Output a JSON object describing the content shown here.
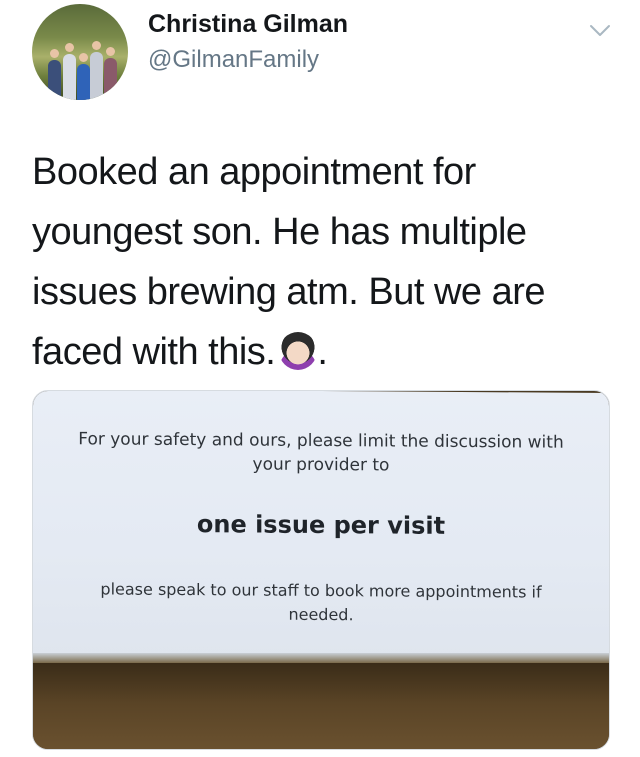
{
  "user": {
    "name": "Christina Gilman",
    "handle": "@GilmanFamily"
  },
  "tweet": {
    "text": "Booked an appointment for youngest son.  He has multiple issues brewing atm.  But we are faced with this.",
    "text_lines": [
      "Booked an appointment for",
      "youngest son.  He has multiple",
      "issues brewing atm.  But we are",
      "faced with this."
    ],
    "trailing_punct": ".",
    "emoji": "woman-facepalming-emoji"
  },
  "media": {
    "sign_line1": "For your safety and ours, please limit the discussion with",
    "sign_line2": "your provider to",
    "sign_headline": "one issue per visit",
    "sign_line3": "please speak to our staff to book more appointments if",
    "sign_line4": "needed."
  },
  "icons": {
    "menu": "chevron-down-icon"
  },
  "colors": {
    "text": "#14171a",
    "secondary": "#657786",
    "chevron": "#aab8c2"
  }
}
